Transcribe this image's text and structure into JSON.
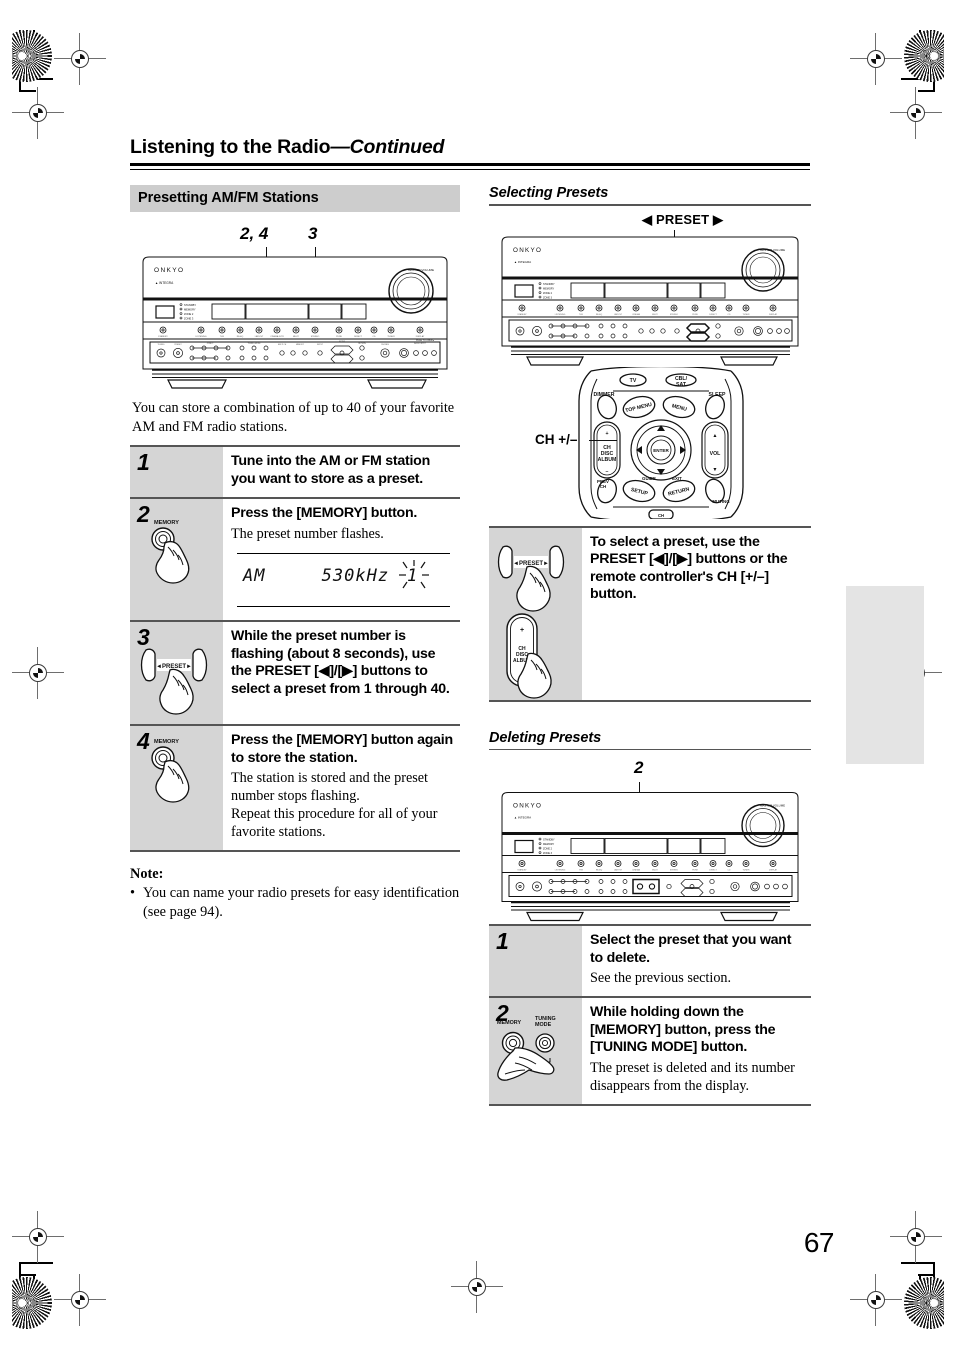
{
  "page": {
    "title_main": "Listening to the Radio",
    "title_continued": "—Continued",
    "page_number": "67"
  },
  "left_column": {
    "section_heading": "Presetting AM/FM Stations",
    "device_callouts": [
      "2, 4",
      "3"
    ],
    "device_brand": "ONKYO",
    "intro": "You can store a combination of up to 40 of your favorite AM and FM radio stations.",
    "steps": [
      {
        "number": "1",
        "icon": "none",
        "bold": "Tune into the AM or FM station you want to store as a preset.",
        "plain": ""
      },
      {
        "number": "2",
        "icon": "memory-button-press",
        "icon_label": "MEMORY",
        "bold": "Press the [MEMORY] button.",
        "plain": "The preset number flashes.",
        "lcd": {
          "band": "AM",
          "frequency": "530kHz",
          "preset_number": "1",
          "flashing": true
        }
      },
      {
        "number": "3",
        "icon": "preset-rocker-press",
        "icon_label": "PRESET",
        "bold": "While the preset number is flashing (about 8 seconds), use the PRESET [◀]/[▶] buttons to select a preset from 1 through 40.",
        "plain": ""
      },
      {
        "number": "4",
        "icon": "memory-button-press",
        "icon_label": "MEMORY",
        "bold": "Press the [MEMORY] button again to store the station.",
        "plain": "The station is stored and the preset number stops flashing.\nRepeat this procedure for all of your favorite stations."
      }
    ],
    "note_heading": "Note:",
    "note_items": [
      "You can name your radio presets for easy identification (see page 94)."
    ]
  },
  "right_column": {
    "selecting": {
      "heading": "Selecting Presets",
      "device_label": "◀ PRESET ▶",
      "device_brand": "ONKYO",
      "remote_label": "CH +/–",
      "remote_buttons": {
        "top_left": "TV",
        "top_right": "CBL/SAT",
        "dimmer": "DIMMER",
        "sleep": "SLEEP",
        "top_menu": "TOP MENU",
        "menu": "MENU",
        "enter": "ENTER",
        "vol": "VOL",
        "ch_disc_album": "CH\nDISC\nALBUM",
        "plus": "+",
        "minus": "–",
        "prev_ch": "PREV\nCH",
        "setup": "SETUP",
        "return": "RETURN",
        "muting": "MUTING",
        "guide": "GUIDE",
        "exit": "EXIT"
      },
      "callout_bold": "To select a preset, use the PRESET [◀]/[▶] buttons or the remote controller's CH [+/–] button.",
      "icon_preset_label": "PRESET",
      "icon_ch_labels": [
        "+",
        "CH",
        "DISC",
        "ALBUM",
        "–"
      ]
    },
    "deleting": {
      "heading": "Deleting Presets",
      "device_callout": "2",
      "device_brand": "ONKYO",
      "steps": [
        {
          "number": "1",
          "icon": "none",
          "bold": "Select the preset that you want to delete.",
          "plain": "See the previous section."
        },
        {
          "number": "2",
          "icon": "memory-tuning-mode-press",
          "icon_labels": [
            "MEMORY",
            "TUNING MODE"
          ],
          "icon_sublabel": "CLEAR",
          "bold": "While holding down the [MEMORY] button, press the [TUNING MODE] button.",
          "plain": "The preset is deleted and its number disappears from the display."
        }
      ]
    }
  },
  "colors": {
    "section_header_bg": "#cdcdcd",
    "step_num_bg": "#d5d5d5",
    "rule": "#555555",
    "thumb_tab": "#e4e4e4"
  }
}
